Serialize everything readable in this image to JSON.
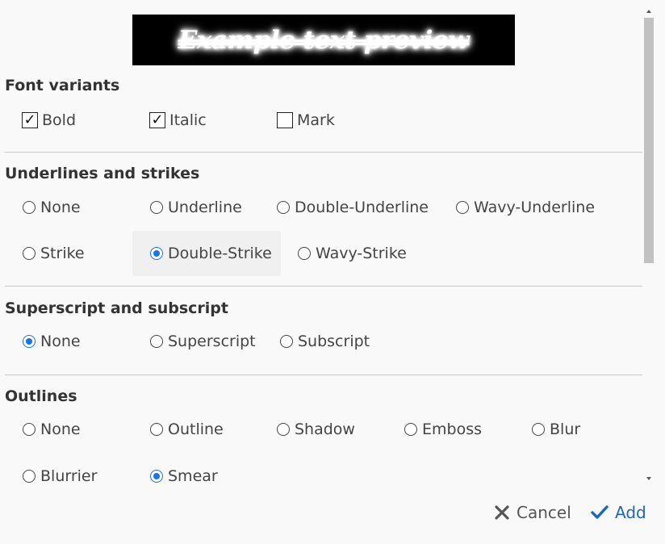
{
  "preview": {
    "text": "Example text preview"
  },
  "sections": {
    "font_variants": {
      "title": "Font variants",
      "options": [
        {
          "label": "Bold",
          "checked": true
        },
        {
          "label": "Italic",
          "checked": true
        },
        {
          "label": "Mark",
          "checked": false
        }
      ]
    },
    "underlines": {
      "title": "Underlines and strikes",
      "options": [
        {
          "label": "None",
          "checked": false
        },
        {
          "label": "Underline",
          "checked": false
        },
        {
          "label": "Double-Underline",
          "checked": false
        },
        {
          "label": "Wavy-Underline",
          "checked": false
        },
        {
          "label": "Strike",
          "checked": false
        },
        {
          "label": "Double-Strike",
          "checked": true
        },
        {
          "label": "Wavy-Strike",
          "checked": false
        }
      ]
    },
    "scripts": {
      "title": "Superscript and subscript",
      "options": [
        {
          "label": "None",
          "checked": true
        },
        {
          "label": "Superscript",
          "checked": false
        },
        {
          "label": "Subscript",
          "checked": false
        }
      ]
    },
    "outlines": {
      "title": "Outlines",
      "options": [
        {
          "label": "None",
          "checked": false
        },
        {
          "label": "Outline",
          "checked": false
        },
        {
          "label": "Shadow",
          "checked": false
        },
        {
          "label": "Emboss",
          "checked": false
        },
        {
          "label": "Blur",
          "checked": false
        },
        {
          "label": "Blurrier",
          "checked": false
        },
        {
          "label": "Smear",
          "checked": true
        }
      ]
    }
  },
  "footer": {
    "cancel_label": "Cancel",
    "add_label": "Add"
  },
  "colors": {
    "accent": "#1a73e8",
    "add_text": "#1a66c0",
    "background": "#f9f9f9",
    "preview_bg": "#000000"
  },
  "icons": {
    "cancel": "close-icon",
    "add": "checkmark-icon"
  }
}
